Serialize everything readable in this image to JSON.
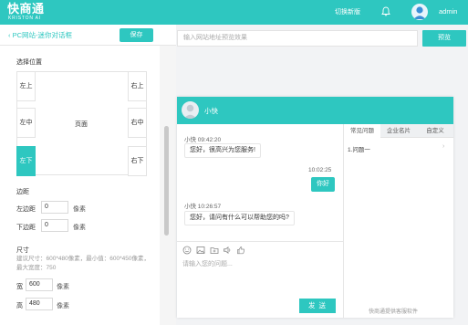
{
  "header": {
    "logo_cn": "快商通",
    "logo_en": "KRISTON AI",
    "switch_label": "切换新版",
    "username": "admin",
    "bg_color": "#2ec7c0"
  },
  "left": {
    "back_label": "PC网站-迷你对话框",
    "save_label": "保存",
    "position_title": "选择位置",
    "positions": {
      "top_left": "左上",
      "top_right": "右上",
      "mid_left": "左中",
      "center": "页面",
      "mid_right": "右中",
      "bottom_left": "左下",
      "bottom_right": "右下",
      "selected": "左下"
    },
    "margin_title": "边距",
    "left_margin_label": "左边距",
    "left_margin_value": "0",
    "bottom_margin_label": "下边距",
    "bottom_margin_value": "0",
    "unit": "像素",
    "size_title": "尺寸",
    "size_hint": "建议尺寸：600*480像素，最小值：600*450像素，最大宽度：750",
    "width_label": "宽",
    "width_value": "600",
    "height_label": "高",
    "height_value": "480"
  },
  "preview": {
    "url_placeholder": "输入网站地址预览效果",
    "preview_label": "预览"
  },
  "chat": {
    "agent_name": "小快",
    "messages": [
      {
        "meta": "小快 09:42:20",
        "text": "您好，很高兴为您服务!"
      },
      {
        "meta": "10:02:25",
        "text": "你好"
      },
      {
        "meta": "小快 10:26:57",
        "text": "您好，请问有什么可以帮助您的吗?"
      }
    ],
    "input_placeholder": "请输入您的问题...",
    "send_label": "发 送",
    "tabs": [
      "常见问题",
      "企业名片",
      "自定义"
    ],
    "faq_item": "1.问题一",
    "powered_by": "快商通提供客服软件"
  }
}
